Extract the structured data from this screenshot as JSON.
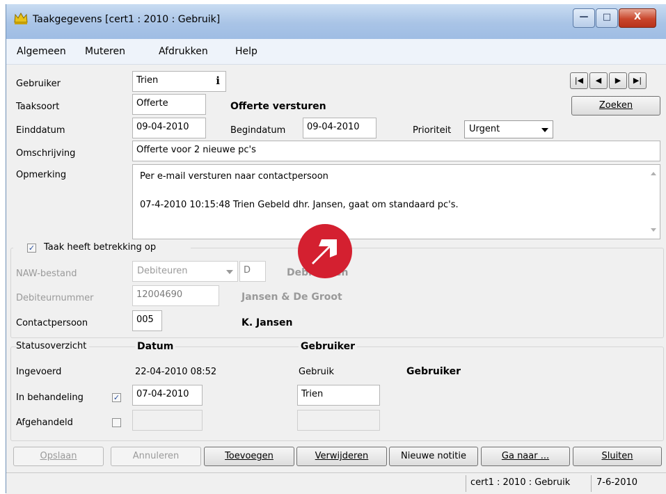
{
  "window": {
    "title": "Taakgegevens  [cert1 : 2010 : Gebruik]",
    "controls": {
      "minimize": "—",
      "maximize": "□",
      "close": "X"
    }
  },
  "menu": [
    {
      "label": "Algemeen"
    },
    {
      "label": "Muteren"
    },
    {
      "label": "Afdrukken"
    },
    {
      "label": "Help"
    }
  ],
  "form": {
    "gebruiker_label": "Gebruiker",
    "gebruiker_value": "Trien",
    "info_icon": "i",
    "taaksoort_label": "Taaksoort",
    "taaksoort_value": "Offerte",
    "taaksoort_desc": "Offerte versturen",
    "einddatum_label": "Einddatum",
    "einddatum_value": "09-04-2010",
    "begindatum_label": "Begindatum",
    "begindatum_value": "09-04-2010",
    "prioriteit_label": "Prioriteit",
    "prioriteit_value": "Urgent",
    "omschrijving_label": "Omschrijving",
    "omschrijving_value": "Offerte voor 2 nieuwe pc's",
    "opmerking_label": "Opmerking",
    "opmerking_lines": [
      "Per e-mail versturen naar contactpersoon",
      "07-4-2010 10:15:48 Trien Gebeld dhr. Jansen, gaat om standaard pc's."
    ]
  },
  "nav": {
    "first": "|◀",
    "prev": "◀",
    "next": "▶",
    "last": "▶|",
    "zoeken": "Zoeken"
  },
  "relation": {
    "checkbox_label": "Taak heeft betrekking op",
    "checked": "✓",
    "naw_label": "NAW-bestand",
    "naw_value": "Debiteuren",
    "naw_code": "D",
    "naw_desc": "Debiteuren",
    "debnr_label": "Debiteurnummer",
    "debnr_value": "12004690",
    "debnr_desc": "Jansen & De Groot",
    "contact_label": "Contactpersoon",
    "contact_value": "005",
    "contact_desc": "K. Jansen"
  },
  "status": {
    "header": "Statusoverzicht",
    "col_datum": "Datum",
    "col_gebruiker": "Gebruiker",
    "ingevoerd_label": "Ingevoerd",
    "ingevoerd_datum": "22-04-2010 08:52",
    "ingevoerd_gebruik": "Gebruik",
    "ingevoerd_gebruiker": "Gebruiker",
    "behandeling_label": "In behandeling",
    "behandeling_check": "✓",
    "behandeling_datum": "07-04-2010",
    "behandeling_gebruiker": "Trien",
    "afgehandeld_label": "Afgehandeld"
  },
  "buttons": {
    "opslaan": "Opslaan",
    "annuleren": "Annuleren",
    "toevoegen": "Toevoegen",
    "verwijderen": "Verwijderen",
    "nieuwe_notitie": "Nieuwe notitie",
    "ga_naar": "Ga naar ...",
    "sluiten": "Sluiten"
  },
  "statusbar": {
    "context": "cert1 : 2010 : Gebruik",
    "date": "7-6-2010"
  },
  "colors": {
    "logo": "#d42030",
    "titlebar": "#a9c4e6",
    "close": "#c9462c"
  }
}
